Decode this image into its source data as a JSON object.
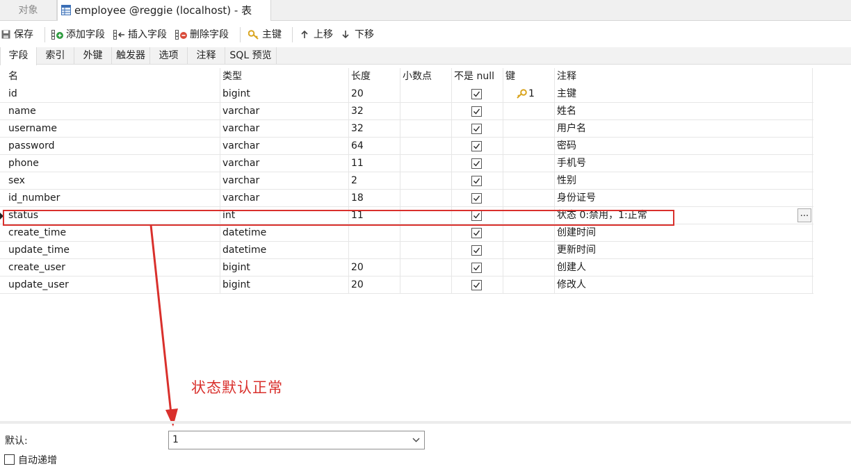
{
  "tabs": {
    "objects": "对象",
    "active_title": "employee @reggie (localhost) - 表"
  },
  "toolbar": {
    "save": "保存",
    "add_field": "添加字段",
    "insert_field": "插入字段",
    "delete_field": "删除字段",
    "primary_key": "主键",
    "move_up": "上移",
    "move_down": "下移"
  },
  "subtabs": [
    "字段",
    "索引",
    "外键",
    "触发器",
    "选项",
    "注释",
    "SQL 预览"
  ],
  "grid": {
    "headers": {
      "name": "名",
      "type": "类型",
      "length": "长度",
      "decimals": "小数点",
      "not_null": "不是 null",
      "key": "键",
      "comment": "注释"
    },
    "rows": [
      {
        "name": "id",
        "type": "bigint",
        "length": "20",
        "decimals": "",
        "not_null": true,
        "key": "1",
        "comment": "主键"
      },
      {
        "name": "name",
        "type": "varchar",
        "length": "32",
        "decimals": "",
        "not_null": true,
        "key": "",
        "comment": "姓名"
      },
      {
        "name": "username",
        "type": "varchar",
        "length": "32",
        "decimals": "",
        "not_null": true,
        "key": "",
        "comment": "用户名"
      },
      {
        "name": "password",
        "type": "varchar",
        "length": "64",
        "decimals": "",
        "not_null": true,
        "key": "",
        "comment": "密码"
      },
      {
        "name": "phone",
        "type": "varchar",
        "length": "11",
        "decimals": "",
        "not_null": true,
        "key": "",
        "comment": "手机号"
      },
      {
        "name": "sex",
        "type": "varchar",
        "length": "2",
        "decimals": "",
        "not_null": true,
        "key": "",
        "comment": "性别"
      },
      {
        "name": "id_number",
        "type": "varchar",
        "length": "18",
        "decimals": "",
        "not_null": true,
        "key": "",
        "comment": "身份证号"
      },
      {
        "name": "status",
        "type": "int",
        "length": "11",
        "decimals": "",
        "not_null": true,
        "key": "",
        "comment": "状态 0:禁用，1:正常"
      },
      {
        "name": "create_time",
        "type": "datetime",
        "length": "",
        "decimals": "",
        "not_null": true,
        "key": "",
        "comment": "创建时间"
      },
      {
        "name": "update_time",
        "type": "datetime",
        "length": "",
        "decimals": "",
        "not_null": true,
        "key": "",
        "comment": "更新时间"
      },
      {
        "name": "create_user",
        "type": "bigint",
        "length": "20",
        "decimals": "",
        "not_null": true,
        "key": "",
        "comment": "创建人"
      },
      {
        "name": "update_user",
        "type": "bigint",
        "length": "20",
        "decimals": "",
        "not_null": true,
        "key": "",
        "comment": "修改人"
      }
    ],
    "ellipsis": "..."
  },
  "annotation": {
    "text": "状态默认正常",
    "color": "#d9302c"
  },
  "bottom": {
    "default_label": "默认:",
    "default_value": "1",
    "auto_increment_label": "自动递增",
    "auto_increment_checked": false
  },
  "icons": {
    "table_tab": "table-icon",
    "save": "save-icon",
    "add_field": "add-field-icon",
    "insert_field": "insert-field-icon",
    "delete_field": "delete-field-icon",
    "primary_key": "key-icon",
    "move_up": "arrow-up-icon",
    "move_down": "arrow-down-icon"
  }
}
